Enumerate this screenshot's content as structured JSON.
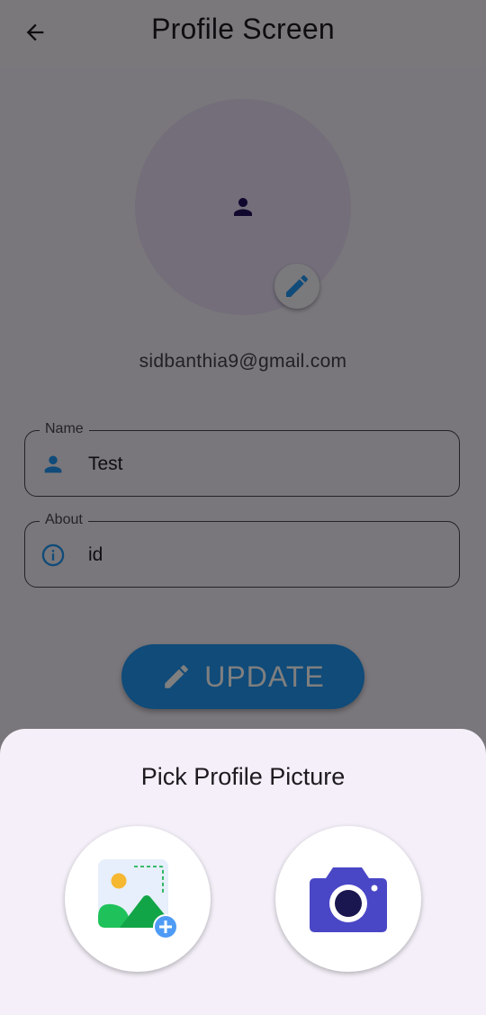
{
  "appbar": {
    "title": "Profile Screen"
  },
  "profile": {
    "email": "sidbanthia9@gmail.com"
  },
  "fields": {
    "name": {
      "label": "Name",
      "value": "Test"
    },
    "about": {
      "label": "About",
      "value": "id"
    }
  },
  "update_button": {
    "label": "UPDATE"
  },
  "sheet": {
    "title": "Pick Profile Picture"
  },
  "colors": {
    "primary": "#2196f3",
    "avatar_bg": "#e7ddf5",
    "camera": "#4a47c6",
    "sheet_bg": "#f4eff8"
  },
  "icons": {
    "back": "arrow-left",
    "avatar": "person",
    "edit": "pencil",
    "name_field": "person",
    "about_field": "info",
    "update": "pencil",
    "gallery": "image-add",
    "camera": "camera"
  }
}
